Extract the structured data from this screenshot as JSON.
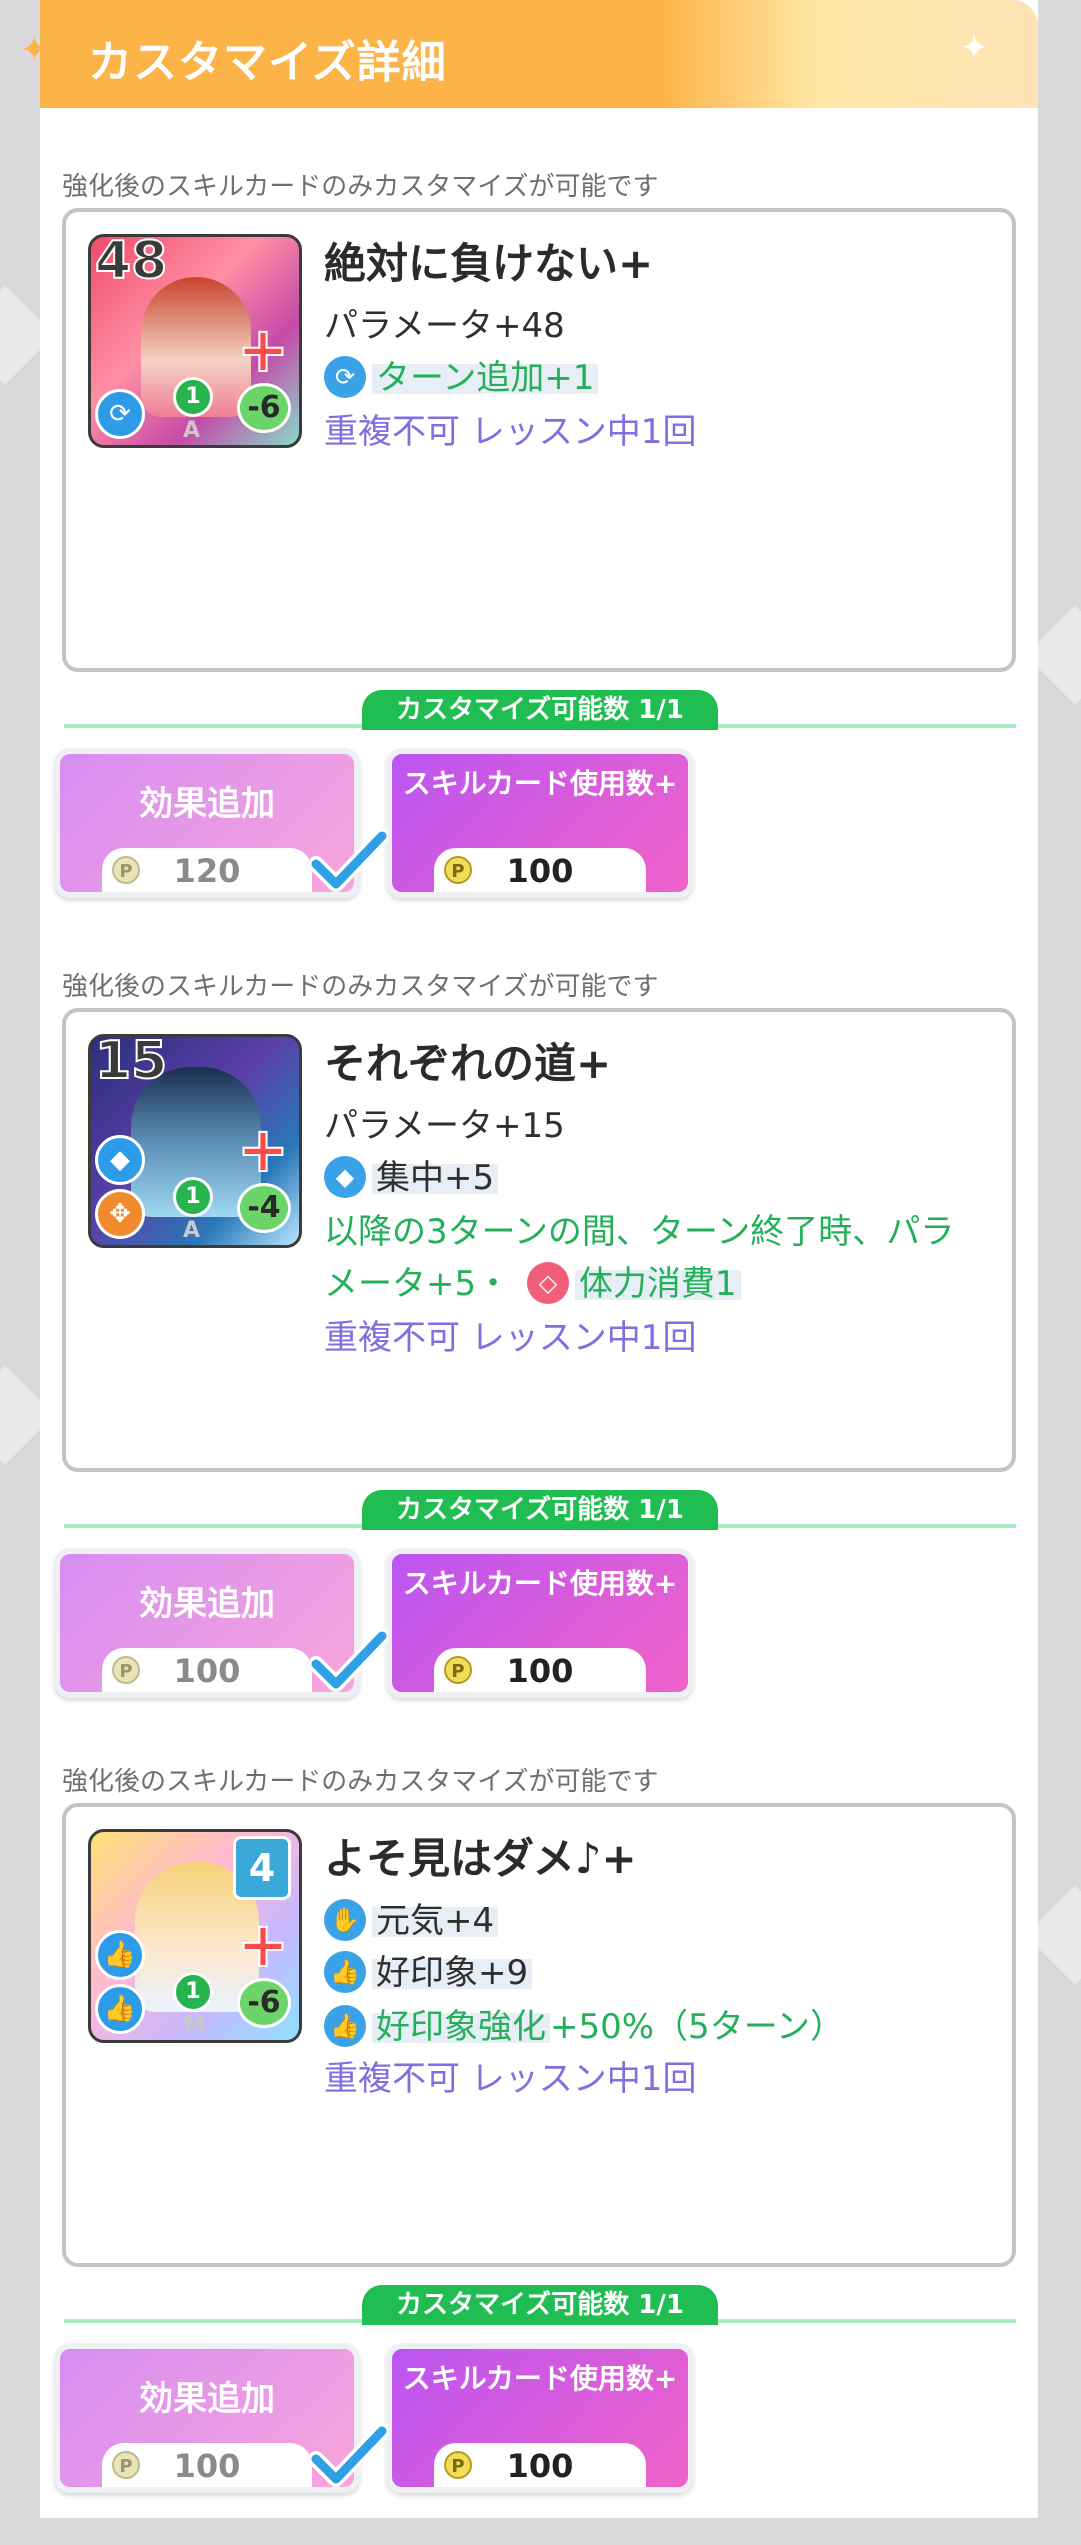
{
  "header": {
    "title": "カスタマイズ詳細"
  },
  "sections": [
    {
      "note": "強化後のスキルカードのみカスタマイズが可能です",
      "card": {
        "thumb_number": "48",
        "level": "1",
        "cost": "-6",
        "rank": "A",
        "name": "絶対に負けない+",
        "lines": [
          "パラメータ+48",
          "ターン追加+1",
          "重複不可 レッスン中1回"
        ]
      },
      "remaining": "カスタマイズ可能数 1/1",
      "buttons": [
        {
          "label": "効果追加",
          "price": "120",
          "selected": true
        },
        {
          "label": "スキルカード使用数+",
          "price": "100",
          "selected": false
        }
      ]
    },
    {
      "note": "強化後のスキルカードのみカスタマイズが可能です",
      "card": {
        "thumb_number": "15",
        "level": "1",
        "cost": "-4",
        "rank": "A",
        "name": "それぞれの道+",
        "lines": [
          "パラメータ+15",
          "集中+5",
          "以降の3ターンの間、ターン終了時、パラ",
          "メータ+5・",
          "体力消費1",
          "重複不可 レッスン中1回"
        ]
      },
      "remaining": "カスタマイズ可能数 1/1",
      "buttons": [
        {
          "label": "効果追加",
          "price": "100",
          "selected": true
        },
        {
          "label": "スキルカード使用数+",
          "price": "100",
          "selected": false
        }
      ]
    },
    {
      "note": "強化後のスキルカードのみカスタマイズが可能です",
      "card": {
        "thumb_number": "4",
        "level": "1",
        "cost": "-6",
        "rank": "M",
        "name": "よそ見はダメ♪+",
        "lines": [
          "元気+4",
          "好印象+9",
          "好印象強化",
          "+50%（5ターン）",
          "重複不可 レッスン中1回"
        ]
      },
      "remaining": "カスタマイズ可能数 1/1",
      "buttons": [
        {
          "label": "効果追加",
          "price": "100",
          "selected": true
        },
        {
          "label": "スキルカード使用数+",
          "price": "100",
          "selected": false
        }
      ]
    }
  ],
  "colors": {
    "header_orange": "#fcb347",
    "effect_green": "#24b05a",
    "limit_purple": "#7f6fe0",
    "pill_green": "#1fbd52",
    "check_blue": "#2f9fe6"
  },
  "icons": {
    "coin": "P",
    "turn": "clock-arrow-icon",
    "focus": "focus-icon",
    "stamina": "stamina-diamond-icon",
    "genki": "genki-hand-icon",
    "goodimpression": "thumbs-up-icon"
  }
}
